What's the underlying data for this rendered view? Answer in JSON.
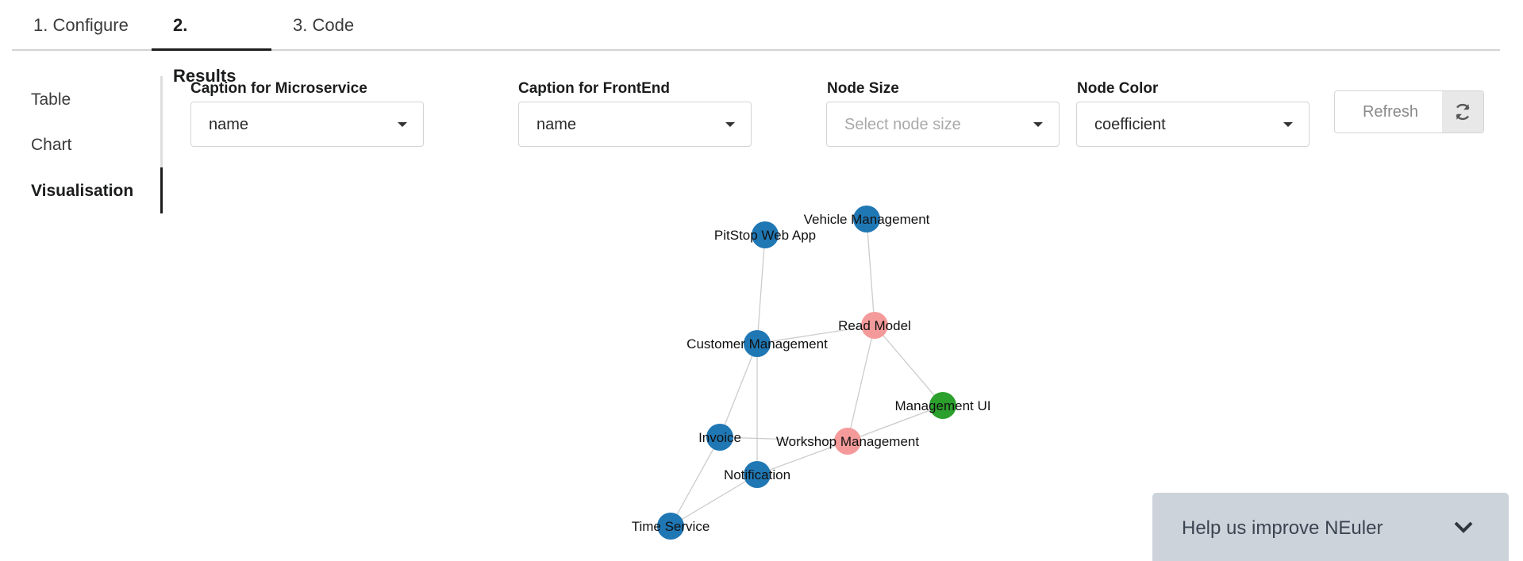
{
  "tabs": [
    {
      "label": "1. Configure"
    },
    {
      "label": "2. Results",
      "active": true
    },
    {
      "label": "3. Code"
    }
  ],
  "side_menu": [
    {
      "label": "Table"
    },
    {
      "label": "Chart"
    },
    {
      "label": "Visualisation",
      "active": true
    }
  ],
  "form": {
    "caption_microservice": {
      "label": "Caption for Microservice",
      "value": "name"
    },
    "caption_frontend": {
      "label": "Caption for FrontEnd",
      "value": "name"
    },
    "node_size": {
      "label": "Node Size",
      "placeholder": "Select node size"
    },
    "node_color": {
      "label": "Node Color",
      "value": "coefficient"
    },
    "refresh_label": "Refresh"
  },
  "graph": {
    "nodes": [
      {
        "id": "pitstop",
        "label": "PitStop Web App",
        "color": "#1f77b4"
      },
      {
        "id": "vehicle",
        "label": "Vehicle Management",
        "color": "#1f77b4"
      },
      {
        "id": "readmodel",
        "label": "Read Model",
        "color": "#f59a9a"
      },
      {
        "id": "customer",
        "label": "Customer Management",
        "color": "#1f77b4"
      },
      {
        "id": "mgmtui",
        "label": "Management UI",
        "color": "#2ca02c"
      },
      {
        "id": "invoice",
        "label": "Invoice",
        "color": "#1f77b4"
      },
      {
        "id": "workshop",
        "label": "Workshop Management",
        "color": "#f59a9a"
      },
      {
        "id": "notification",
        "label": "Notification",
        "color": "#1f77b4"
      },
      {
        "id": "timeservice",
        "label": "Time Service",
        "color": "#1f77b4"
      }
    ],
    "edges": [
      [
        "pitstop",
        "customer"
      ],
      [
        "vehicle",
        "readmodel"
      ],
      [
        "customer",
        "readmodel"
      ],
      [
        "readmodel",
        "mgmtui"
      ],
      [
        "readmodel",
        "workshop"
      ],
      [
        "mgmtui",
        "workshop"
      ],
      [
        "customer",
        "invoice"
      ],
      [
        "customer",
        "notification"
      ],
      [
        "invoice",
        "workshop"
      ],
      [
        "invoice",
        "timeservice"
      ],
      [
        "notification",
        "workshop"
      ],
      [
        "notification",
        "timeservice"
      ]
    ],
    "edge_color": "#cccccc"
  },
  "feedback": {
    "label": "Help us improve NEuler"
  }
}
